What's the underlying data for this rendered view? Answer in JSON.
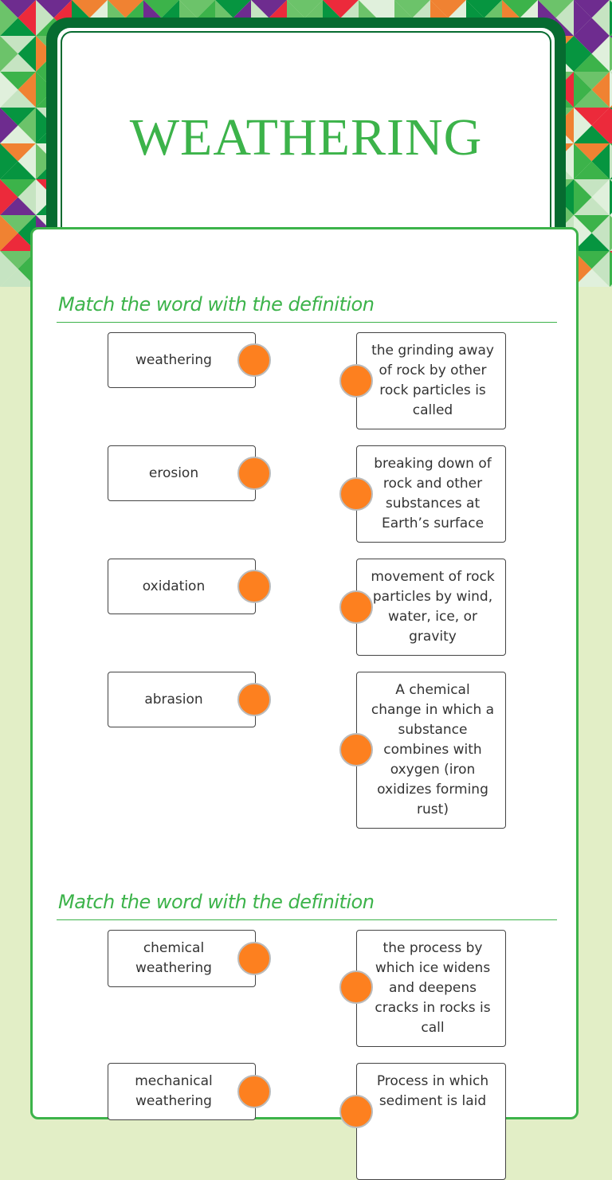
{
  "title": "WEATHERING",
  "colors": {
    "accent_green": "#3cb34a",
    "dark_green": "#066b30",
    "page_bg": "#e2eec6",
    "connector_orange": "#fd801f"
  },
  "sections": [
    {
      "heading": "Match the word with the definition",
      "words": [
        "weathering",
        "erosion",
        "oxidation",
        "abrasion"
      ],
      "definitions": [
        "the grinding away of rock by other rock particles is called",
        "breaking down of rock and other substances at Earth’s surface",
        "movement of rock particles by wind, water, ice, or gravity",
        "A chemical change in which a substance combines with oxygen (iron oxidizes forming rust)"
      ]
    },
    {
      "heading": "Match the word with the definition",
      "words": [
        "chemical weathering",
        "mechanical weathering"
      ],
      "definitions": [
        "the process by which ice widens and deepens cracks in rocks is call",
        "Process in which sediment is laid"
      ]
    }
  ]
}
